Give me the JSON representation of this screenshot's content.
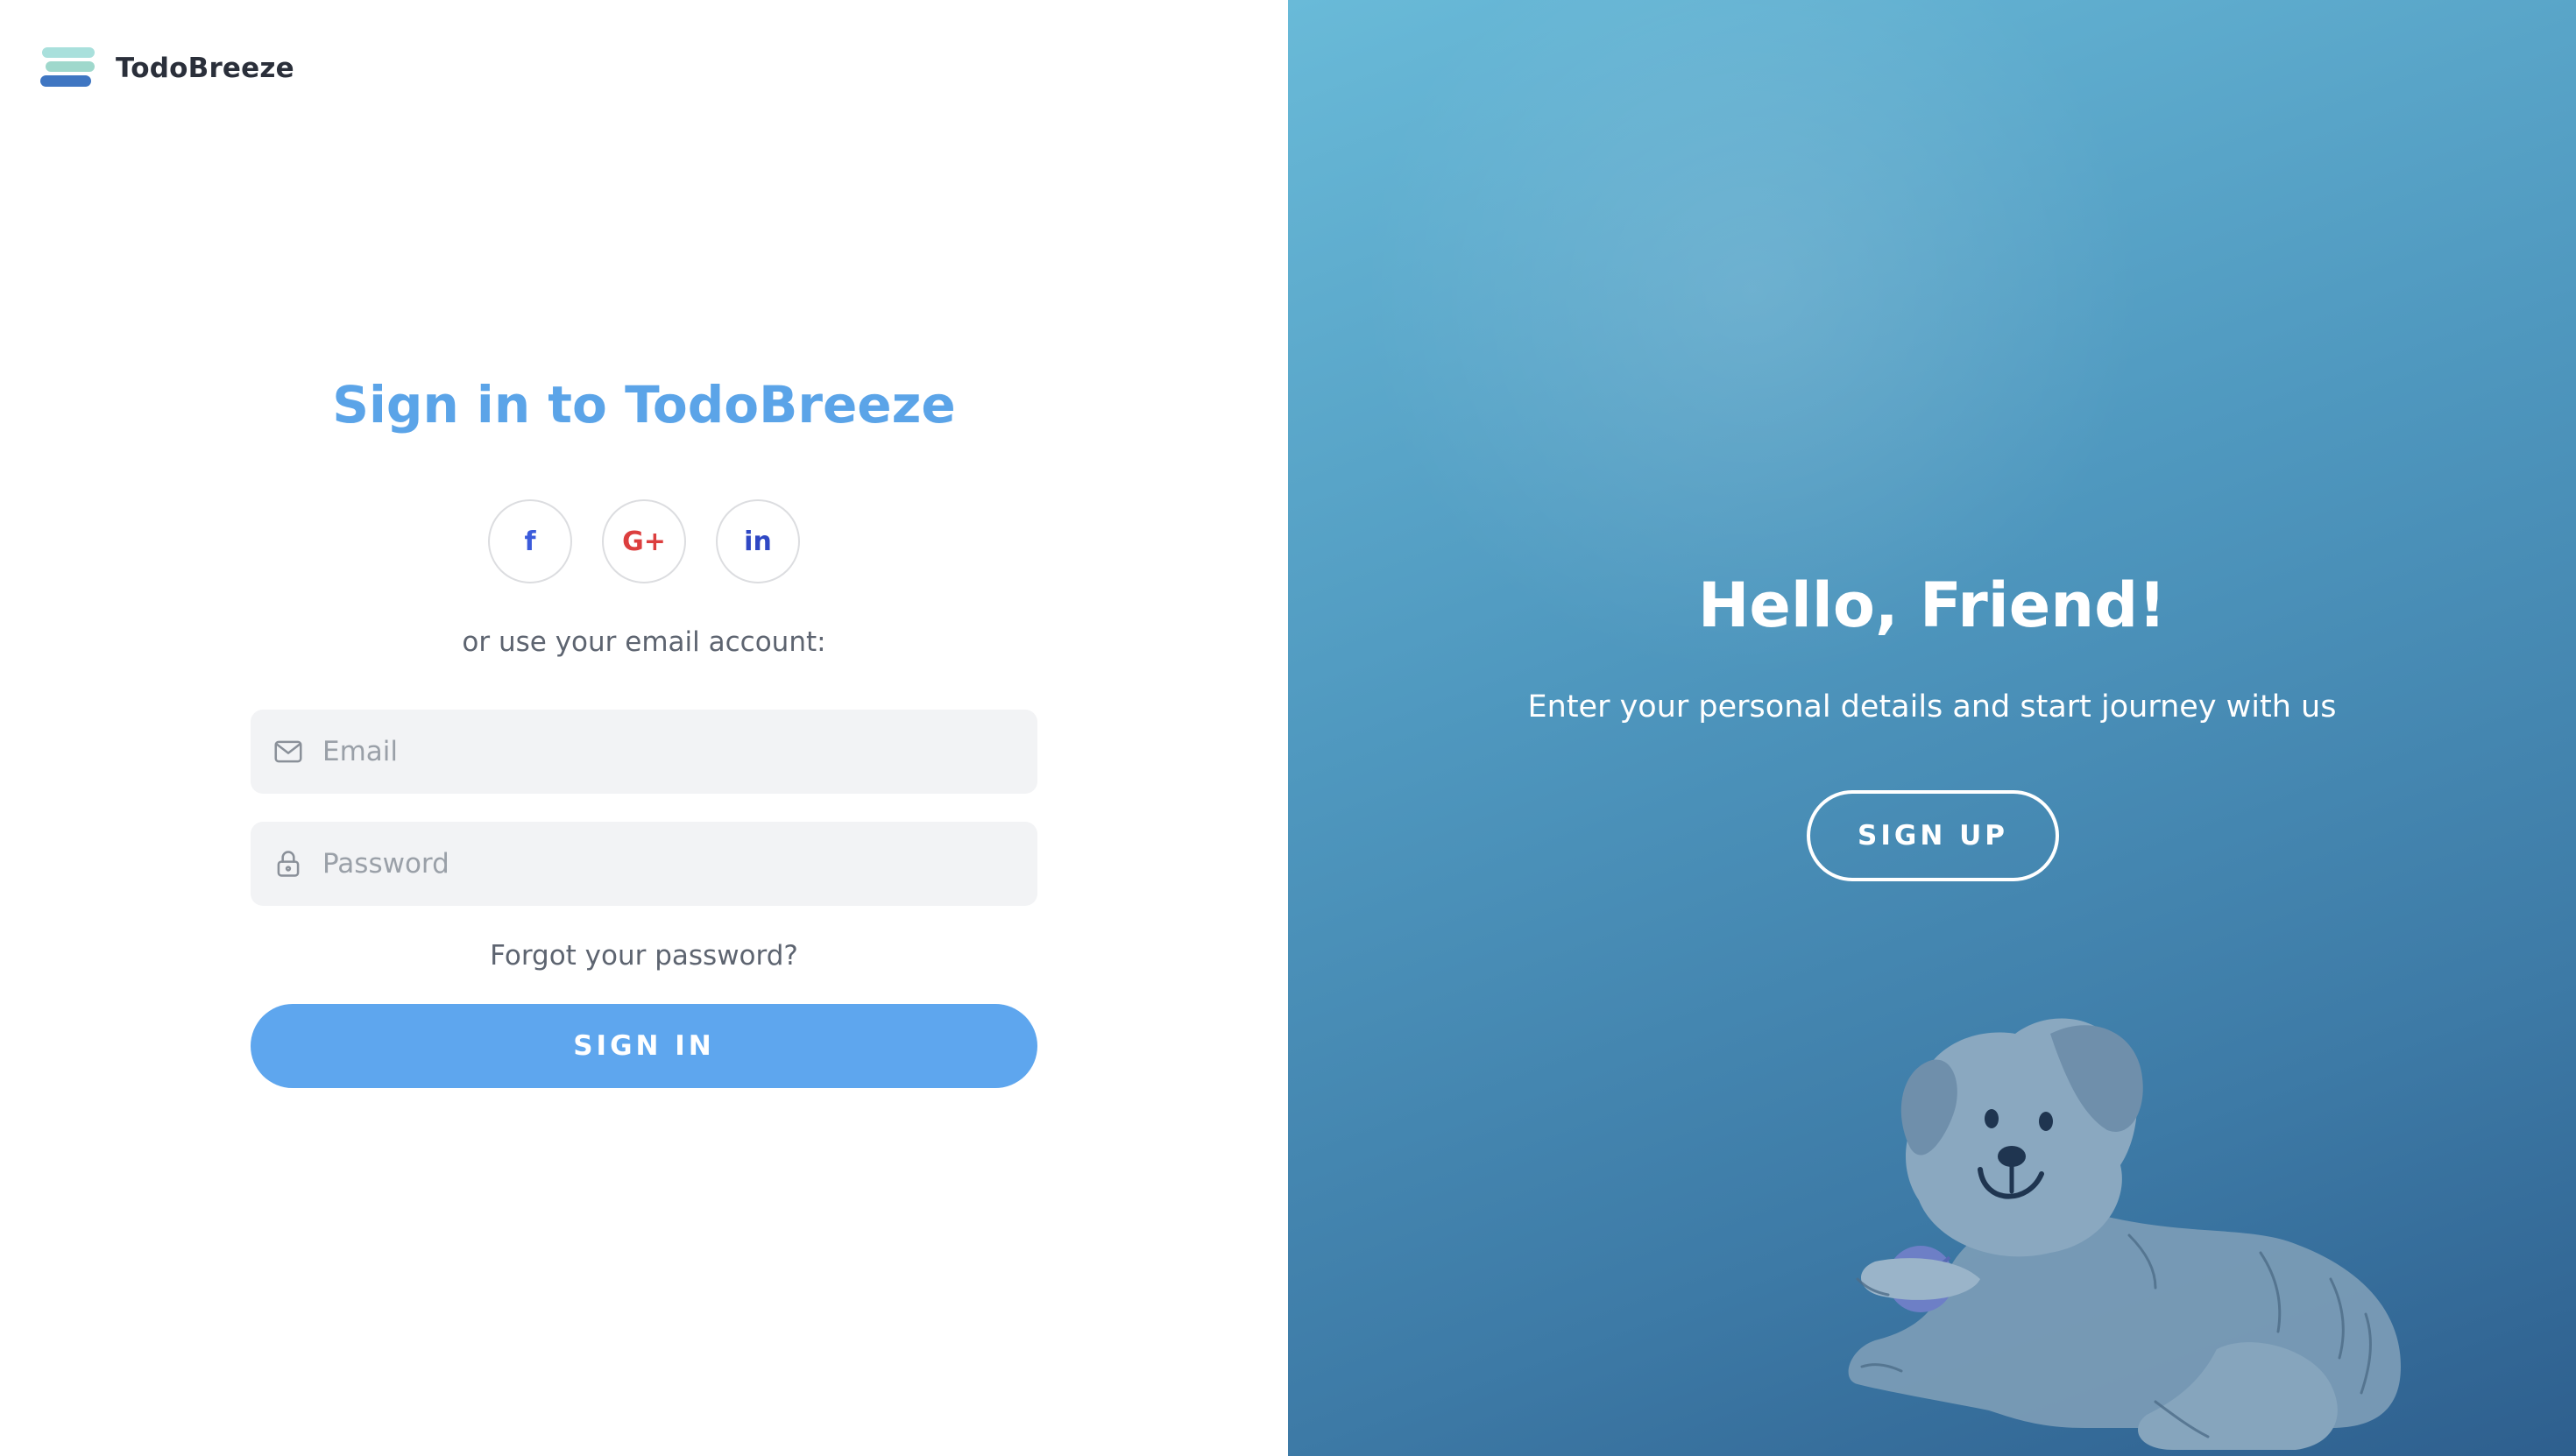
{
  "brand": {
    "name": "TodoBreeze",
    "logo_icon": "stacked-waves-logo",
    "colors": {
      "teal": "#9fdcd8",
      "mint": "#b6e6e0",
      "blue": "#3f76c2"
    }
  },
  "signin": {
    "title": "Sign in to TodoBreeze",
    "social": [
      {
        "label": "f",
        "icon": "facebook-icon"
      },
      {
        "label": "G+",
        "icon": "google-plus-icon"
      },
      {
        "label": "in",
        "icon": "linkedin-icon"
      }
    ],
    "alt_text": "or use your email account:",
    "email_placeholder": "Email",
    "password_placeholder": "Password",
    "forgot_label": "Forgot your password?",
    "button_label": "SIGN IN"
  },
  "welcome": {
    "title": "Hello, Friend!",
    "subtitle": "Enter your personal details and start journey with us",
    "button_label": "SIGN UP",
    "illustration": "dog-illustration"
  },
  "colors": {
    "accent": "#5ea6ee",
    "title": "#5ba4e8",
    "panel_gradient_start": "#69bad8",
    "panel_gradient_end": "#2e5f8e"
  }
}
